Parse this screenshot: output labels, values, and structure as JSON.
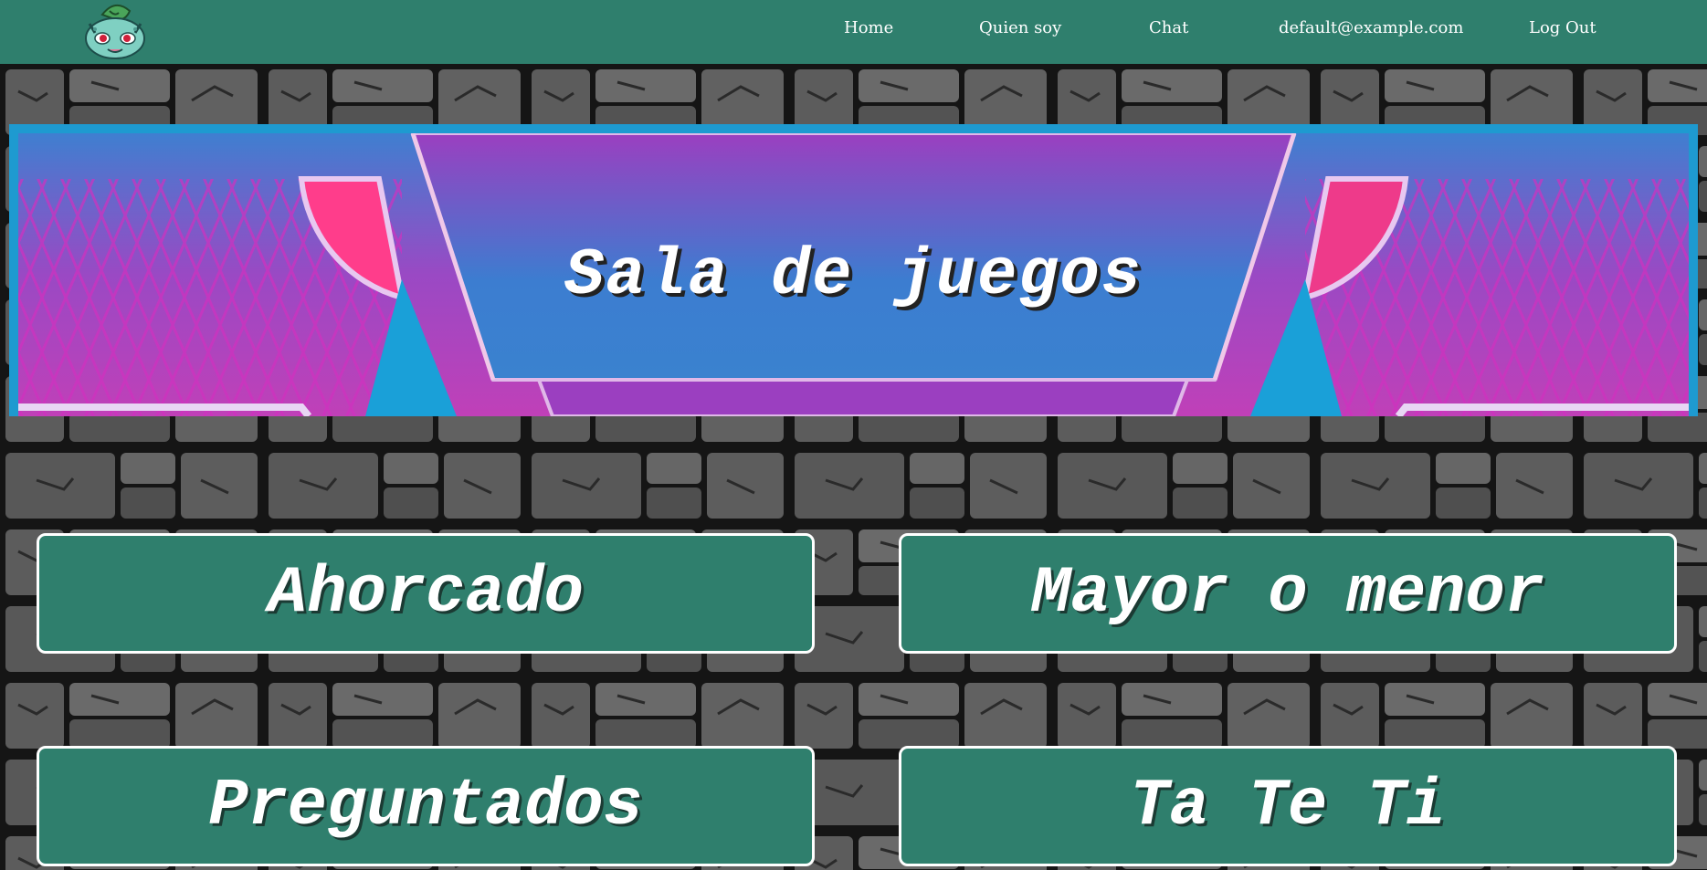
{
  "navbar": {
    "logo_icon": "bulbasaur-logo",
    "links": {
      "home": "Home",
      "quien_soy": "Quien soy",
      "chat": "Chat",
      "email": "default@example.com",
      "logout": "Log Out"
    }
  },
  "banner": {
    "title": "Sala de juegos"
  },
  "games": {
    "ahorcado": "Ahorcado",
    "mayor_o_menor": "Mayor o menor",
    "preguntados": "Preguntados",
    "ta_te_ti": "Ta Te Ti"
  },
  "colors": {
    "accent": "#2f7f6d",
    "banner_border": "#1e9ad0",
    "banner_pink": "#ff3d8b",
    "banner_purple": "#9b45c2"
  }
}
